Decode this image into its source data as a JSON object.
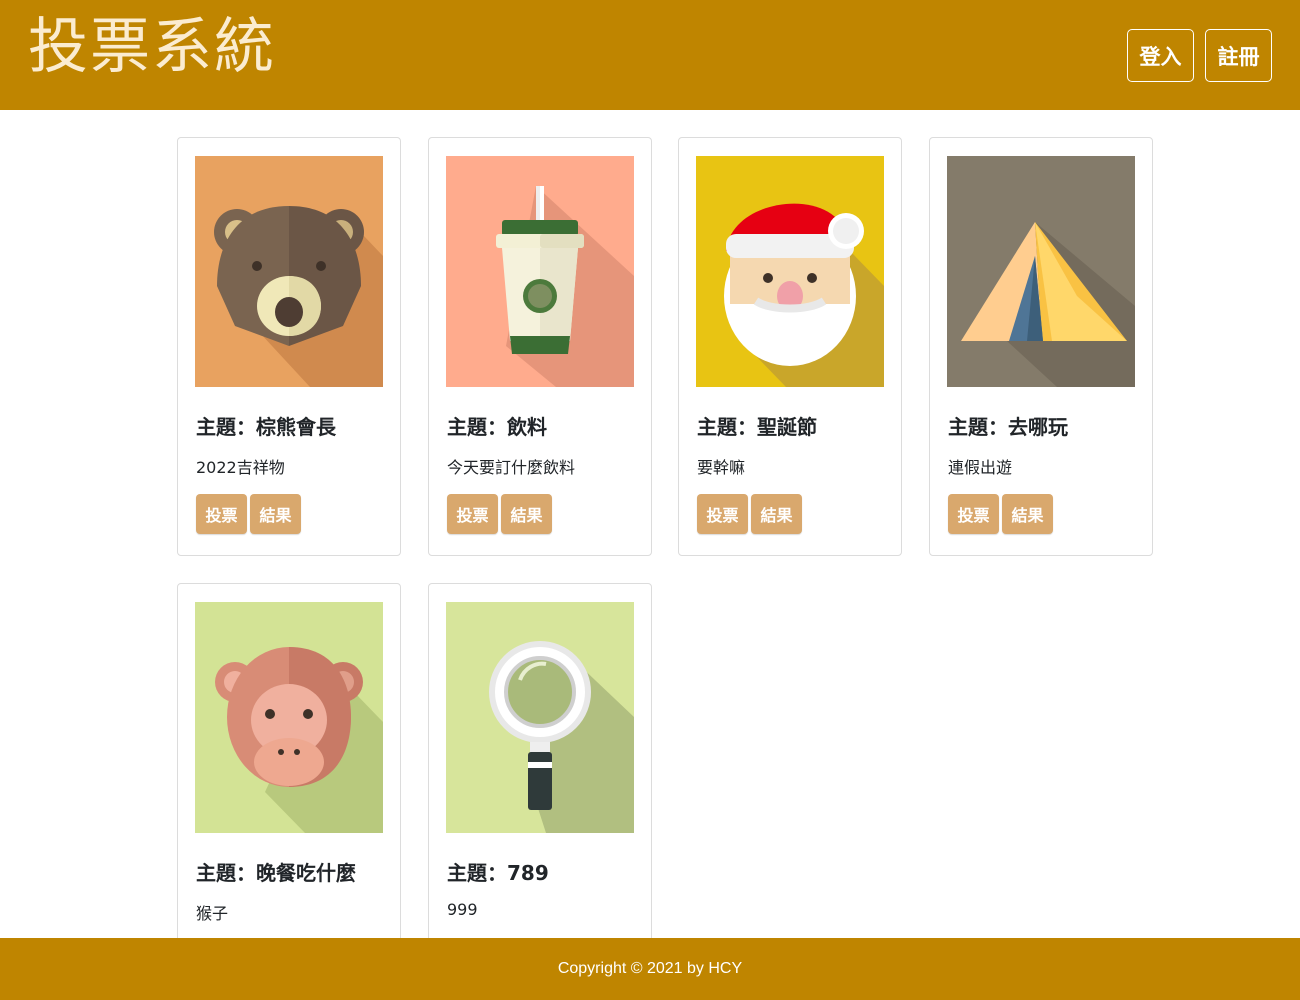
{
  "header": {
    "title": "投票系統",
    "login_label": "登入",
    "register_label": "註冊"
  },
  "cards": [
    {
      "title": "主題：棕熊會長",
      "desc": "2022吉祥物",
      "vote_label": "投票",
      "result_label": "結果",
      "image": "bear-icon"
    },
    {
      "title": "主題：飲料",
      "desc": "今天要訂什麼飲料",
      "vote_label": "投票",
      "result_label": "結果",
      "image": "drink-cup-icon"
    },
    {
      "title": "主題：聖誕節",
      "desc": "要幹嘛",
      "vote_label": "投票",
      "result_label": "結果",
      "image": "santa-icon"
    },
    {
      "title": "主題：去哪玩",
      "desc": "連假出遊",
      "vote_label": "投票",
      "result_label": "結果",
      "image": "tent-icon"
    },
    {
      "title": "主題：晚餐吃什麼",
      "desc": "猴子",
      "image": "monkey-icon"
    },
    {
      "title": "主題：789",
      "desc": "999",
      "image": "magnifier-icon"
    }
  ],
  "footer": {
    "copyright": "Copyright © 2021 by HCY"
  },
  "colors": {
    "brand": "#bf8500",
    "button": "#d9a86d"
  }
}
